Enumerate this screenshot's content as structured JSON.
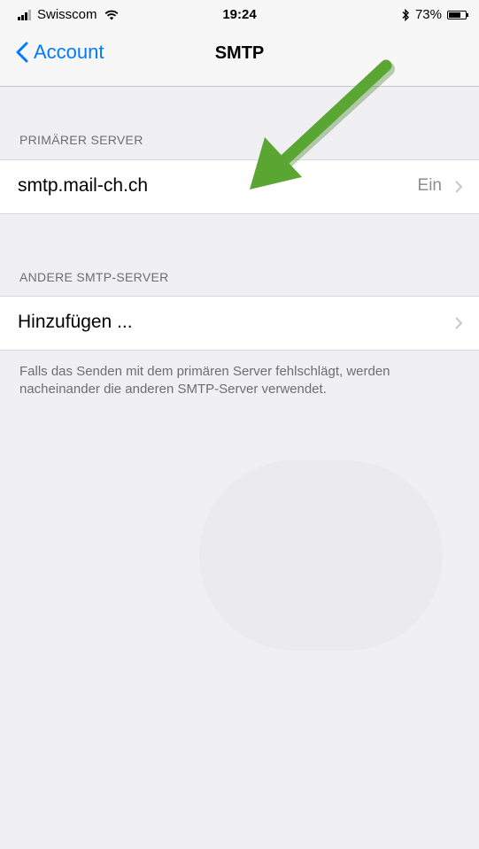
{
  "status_bar": {
    "carrier": "Swisscom",
    "time": "19:24",
    "battery_percent": "73%",
    "battery_level": 0.73
  },
  "nav": {
    "back_label": "Account",
    "title": "SMTP"
  },
  "primary_section": {
    "header": "PRIMÄRER SERVER",
    "server": "smtp.mail-ch.ch",
    "status": "Ein"
  },
  "other_section": {
    "header": "ANDERE SMTP-SERVER",
    "add_label": "Hinzufügen ...",
    "footer": "Falls das Senden mit dem primären Server fehlschlägt, werden nacheinander die anderen SMTP-Server verwendet."
  },
  "annotation": {
    "arrow_color": "#5aa632"
  }
}
